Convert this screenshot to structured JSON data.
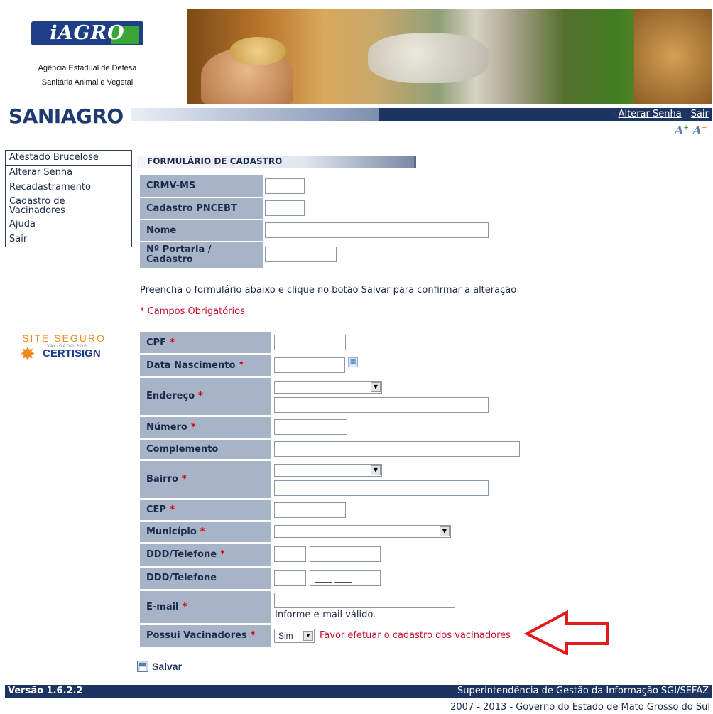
{
  "header": {
    "logo_text": "iAGRO",
    "org_line1": "Agência Estadual de Defesa",
    "org_line2": "Sanitária Animal e Vegetal",
    "app_title": "SANIAGRO",
    "links": {
      "sep1": "- ",
      "change_password": "Alterar Senha",
      "sep2": " - ",
      "logout": "Sair"
    }
  },
  "sidebar": {
    "items": [
      {
        "label": "Atestado Brucelose"
      },
      {
        "label": "Alterar Senha"
      },
      {
        "label": "Recadastramento"
      },
      {
        "label": "Cadastro de Vacinadores"
      },
      {
        "label": "Ajuda"
      },
      {
        "label": "Sair"
      }
    ],
    "seal": {
      "line1": "SITE SEGURO",
      "line2": "VALIDADO POR",
      "line3": "CERTISIGN"
    }
  },
  "form": {
    "title": "FORMULÁRIO DE CADASTRO",
    "crmv_label": "CRMV-MS",
    "pncebt_label": "Cadastro PNCEBT",
    "nome_label": "Nome",
    "portaria_label": "Nº Portaria / Cadastro",
    "instructions": "Preencha o formulário abaixo e clique no botão Salvar para confirmar a alteração",
    "required_note": "* Campos Obrigatórios",
    "cpf_label": "CPF",
    "nascimento_label": "Data Nascimento",
    "endereco_label": "Endereço",
    "numero_label": "Número",
    "complemento_label": "Complemento",
    "bairro_label": "Bairro",
    "cep_label": "CEP",
    "municipio_label": "Município",
    "telefone1_label": "DDD/Telefone",
    "telefone2_label": "DDD/Telefone",
    "telefone2_mask": "____-____",
    "email_label": "E-mail",
    "email_hint": "Informe e-mail válido.",
    "vacinadores_label": "Possui Vacinadores",
    "vacinadores_value": "Sim",
    "vacinadores_warning": "Favor efetuar o cadastro dos vacinadores",
    "required_mark": "*",
    "save_label": "Salvar"
  },
  "footer": {
    "version": "Versão 1.6.2.2",
    "department": "Superintendência de Gestão da Informação SGI/SEFAZ",
    "copyright": "2007 - 2013 - Governo do Estado de Mato Grosso do Sul"
  },
  "colors": {
    "label_bg": "#a7b4c8",
    "bar_dark": "#1c3461",
    "required": "#dd0000",
    "annotation_arrow": "#e21c1c"
  }
}
